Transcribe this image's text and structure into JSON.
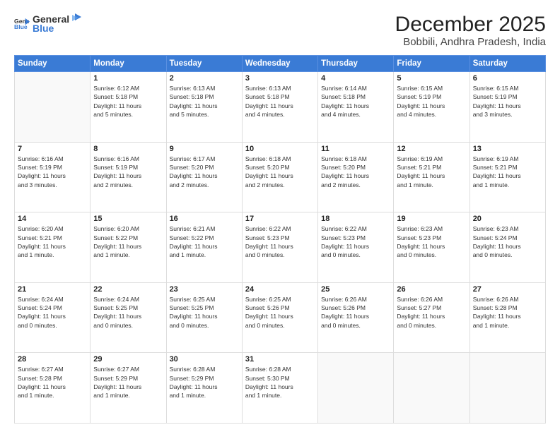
{
  "header": {
    "logo_general": "General",
    "logo_blue": "Blue",
    "month_title": "December 2025",
    "location": "Bobbili, Andhra Pradesh, India"
  },
  "days_of_week": [
    "Sunday",
    "Monday",
    "Tuesday",
    "Wednesday",
    "Thursday",
    "Friday",
    "Saturday"
  ],
  "weeks": [
    [
      {
        "day": "",
        "info": ""
      },
      {
        "day": "1",
        "info": "Sunrise: 6:12 AM\nSunset: 5:18 PM\nDaylight: 11 hours\nand 5 minutes."
      },
      {
        "day": "2",
        "info": "Sunrise: 6:13 AM\nSunset: 5:18 PM\nDaylight: 11 hours\nand 5 minutes."
      },
      {
        "day": "3",
        "info": "Sunrise: 6:13 AM\nSunset: 5:18 PM\nDaylight: 11 hours\nand 4 minutes."
      },
      {
        "day": "4",
        "info": "Sunrise: 6:14 AM\nSunset: 5:18 PM\nDaylight: 11 hours\nand 4 minutes."
      },
      {
        "day": "5",
        "info": "Sunrise: 6:15 AM\nSunset: 5:19 PM\nDaylight: 11 hours\nand 4 minutes."
      },
      {
        "day": "6",
        "info": "Sunrise: 6:15 AM\nSunset: 5:19 PM\nDaylight: 11 hours\nand 3 minutes."
      }
    ],
    [
      {
        "day": "7",
        "info": "Sunrise: 6:16 AM\nSunset: 5:19 PM\nDaylight: 11 hours\nand 3 minutes."
      },
      {
        "day": "8",
        "info": "Sunrise: 6:16 AM\nSunset: 5:19 PM\nDaylight: 11 hours\nand 2 minutes."
      },
      {
        "day": "9",
        "info": "Sunrise: 6:17 AM\nSunset: 5:20 PM\nDaylight: 11 hours\nand 2 minutes."
      },
      {
        "day": "10",
        "info": "Sunrise: 6:18 AM\nSunset: 5:20 PM\nDaylight: 11 hours\nand 2 minutes."
      },
      {
        "day": "11",
        "info": "Sunrise: 6:18 AM\nSunset: 5:20 PM\nDaylight: 11 hours\nand 2 minutes."
      },
      {
        "day": "12",
        "info": "Sunrise: 6:19 AM\nSunset: 5:21 PM\nDaylight: 11 hours\nand 1 minute."
      },
      {
        "day": "13",
        "info": "Sunrise: 6:19 AM\nSunset: 5:21 PM\nDaylight: 11 hours\nand 1 minute."
      }
    ],
    [
      {
        "day": "14",
        "info": "Sunrise: 6:20 AM\nSunset: 5:21 PM\nDaylight: 11 hours\nand 1 minute."
      },
      {
        "day": "15",
        "info": "Sunrise: 6:20 AM\nSunset: 5:22 PM\nDaylight: 11 hours\nand 1 minute."
      },
      {
        "day": "16",
        "info": "Sunrise: 6:21 AM\nSunset: 5:22 PM\nDaylight: 11 hours\nand 1 minute."
      },
      {
        "day": "17",
        "info": "Sunrise: 6:22 AM\nSunset: 5:23 PM\nDaylight: 11 hours\nand 0 minutes."
      },
      {
        "day": "18",
        "info": "Sunrise: 6:22 AM\nSunset: 5:23 PM\nDaylight: 11 hours\nand 0 minutes."
      },
      {
        "day": "19",
        "info": "Sunrise: 6:23 AM\nSunset: 5:23 PM\nDaylight: 11 hours\nand 0 minutes."
      },
      {
        "day": "20",
        "info": "Sunrise: 6:23 AM\nSunset: 5:24 PM\nDaylight: 11 hours\nand 0 minutes."
      }
    ],
    [
      {
        "day": "21",
        "info": "Sunrise: 6:24 AM\nSunset: 5:24 PM\nDaylight: 11 hours\nand 0 minutes."
      },
      {
        "day": "22",
        "info": "Sunrise: 6:24 AM\nSunset: 5:25 PM\nDaylight: 11 hours\nand 0 minutes."
      },
      {
        "day": "23",
        "info": "Sunrise: 6:25 AM\nSunset: 5:25 PM\nDaylight: 11 hours\nand 0 minutes."
      },
      {
        "day": "24",
        "info": "Sunrise: 6:25 AM\nSunset: 5:26 PM\nDaylight: 11 hours\nand 0 minutes."
      },
      {
        "day": "25",
        "info": "Sunrise: 6:26 AM\nSunset: 5:26 PM\nDaylight: 11 hours\nand 0 minutes."
      },
      {
        "day": "26",
        "info": "Sunrise: 6:26 AM\nSunset: 5:27 PM\nDaylight: 11 hours\nand 0 minutes."
      },
      {
        "day": "27",
        "info": "Sunrise: 6:26 AM\nSunset: 5:28 PM\nDaylight: 11 hours\nand 1 minute."
      }
    ],
    [
      {
        "day": "28",
        "info": "Sunrise: 6:27 AM\nSunset: 5:28 PM\nDaylight: 11 hours\nand 1 minute."
      },
      {
        "day": "29",
        "info": "Sunrise: 6:27 AM\nSunset: 5:29 PM\nDaylight: 11 hours\nand 1 minute."
      },
      {
        "day": "30",
        "info": "Sunrise: 6:28 AM\nSunset: 5:29 PM\nDaylight: 11 hours\nand 1 minute."
      },
      {
        "day": "31",
        "info": "Sunrise: 6:28 AM\nSunset: 5:30 PM\nDaylight: 11 hours\nand 1 minute."
      },
      {
        "day": "",
        "info": ""
      },
      {
        "day": "",
        "info": ""
      },
      {
        "day": "",
        "info": ""
      }
    ]
  ]
}
